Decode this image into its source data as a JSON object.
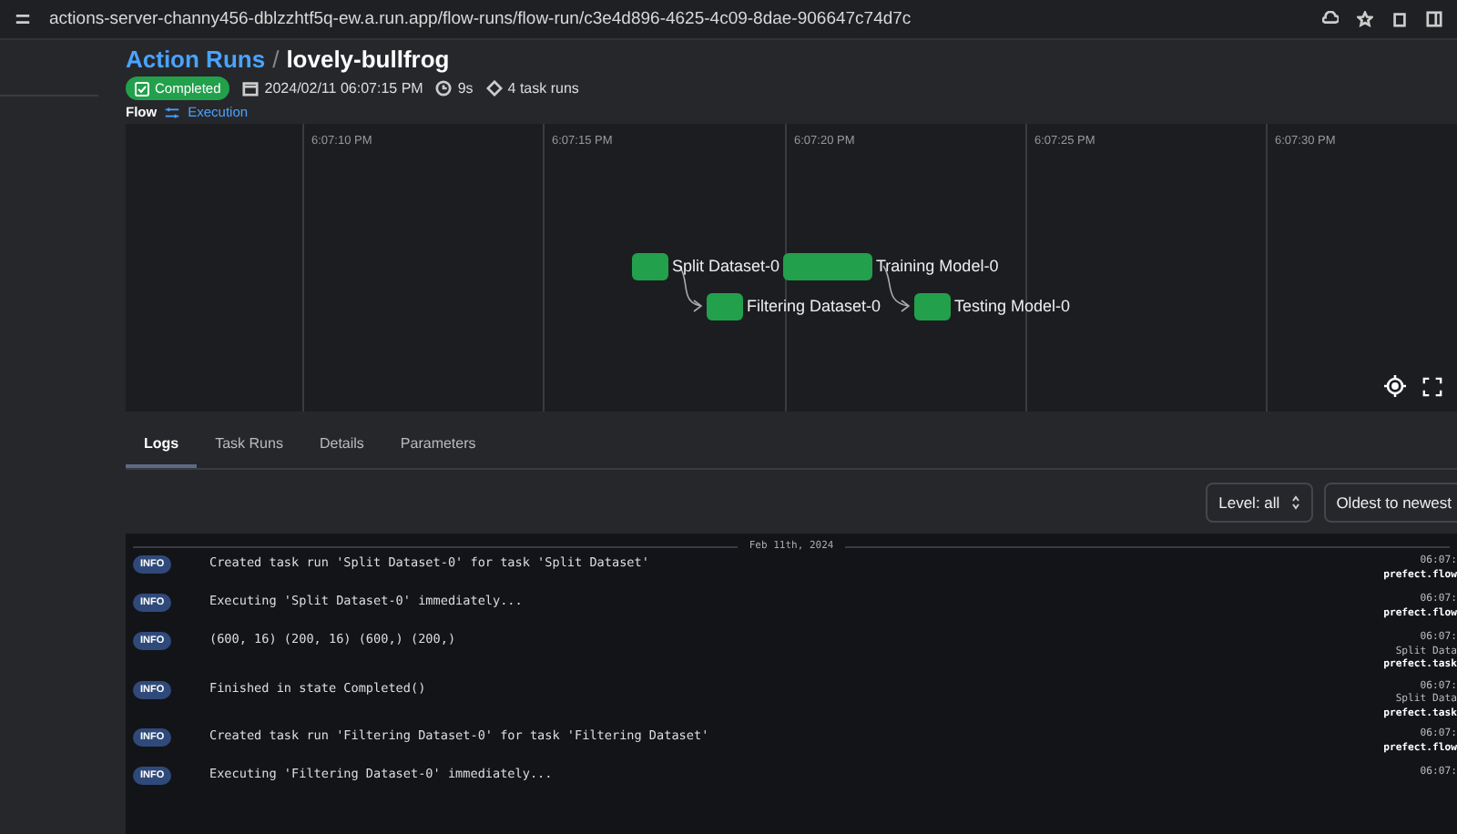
{
  "browser": {
    "url": "actions-server-channy456-dblzzhtf5q-ew.a.run.app/flow-runs/flow-run/c3e4d896-4625-4c09-8dae-906647c74d7c"
  },
  "breadcrumb": {
    "parent": "Action Runs",
    "separator": "/",
    "current": "lovely-bullfrog"
  },
  "meta": {
    "state": "Completed",
    "date": "2024/02/11 06:07:15 PM",
    "duration": "9s",
    "task_runs": "4 task runs"
  },
  "flow": {
    "label": "Flow",
    "link": "Execution"
  },
  "timeline": {
    "ticks": [
      "6:07:10 PM",
      "6:07:15 PM",
      "6:07:20 PM",
      "6:07:25 PM",
      "6:07:30 PM"
    ],
    "nodes": [
      {
        "label": "Split Dataset-0"
      },
      {
        "label": "Training Model-0"
      },
      {
        "label": "Filtering Dataset-0"
      },
      {
        "label": "Testing Model-0"
      }
    ]
  },
  "tabs": [
    {
      "label": "Logs",
      "selected": true
    },
    {
      "label": "Task Runs",
      "selected": false
    },
    {
      "label": "Details",
      "selected": false
    },
    {
      "label": "Parameters",
      "selected": false
    }
  ],
  "filters": {
    "level": "Level: all",
    "order": "Oldest to newest"
  },
  "logs": {
    "date": "Feb 11th, 2024",
    "rows": [
      {
        "level": "INFO",
        "message": "Created task run 'Split Dataset-0' for task 'Split Dataset'",
        "meta": [
          "06:07:",
          "prefect.flow"
        ]
      },
      {
        "level": "INFO",
        "message": "Executing 'Split Dataset-0' immediately...",
        "meta": [
          "06:07:",
          "prefect.flow"
        ]
      },
      {
        "level": "INFO",
        "message": "(600, 16) (200, 16) (600,) (200,)",
        "meta": [
          "06:07:",
          "Split Data",
          "prefect.task"
        ]
      },
      {
        "level": "INFO",
        "message": "Finished in state Completed()",
        "meta": [
          "06:07:",
          "Split Data",
          "prefect.task"
        ]
      },
      {
        "level": "INFO",
        "message": "Created task run 'Filtering Dataset-0' for task 'Filtering Dataset'",
        "meta": [
          "06:07:",
          "prefect.flow"
        ]
      },
      {
        "level": "INFO",
        "message": "Executing 'Filtering Dataset-0' immediately...",
        "meta": [
          "06:07:"
        ]
      }
    ]
  }
}
